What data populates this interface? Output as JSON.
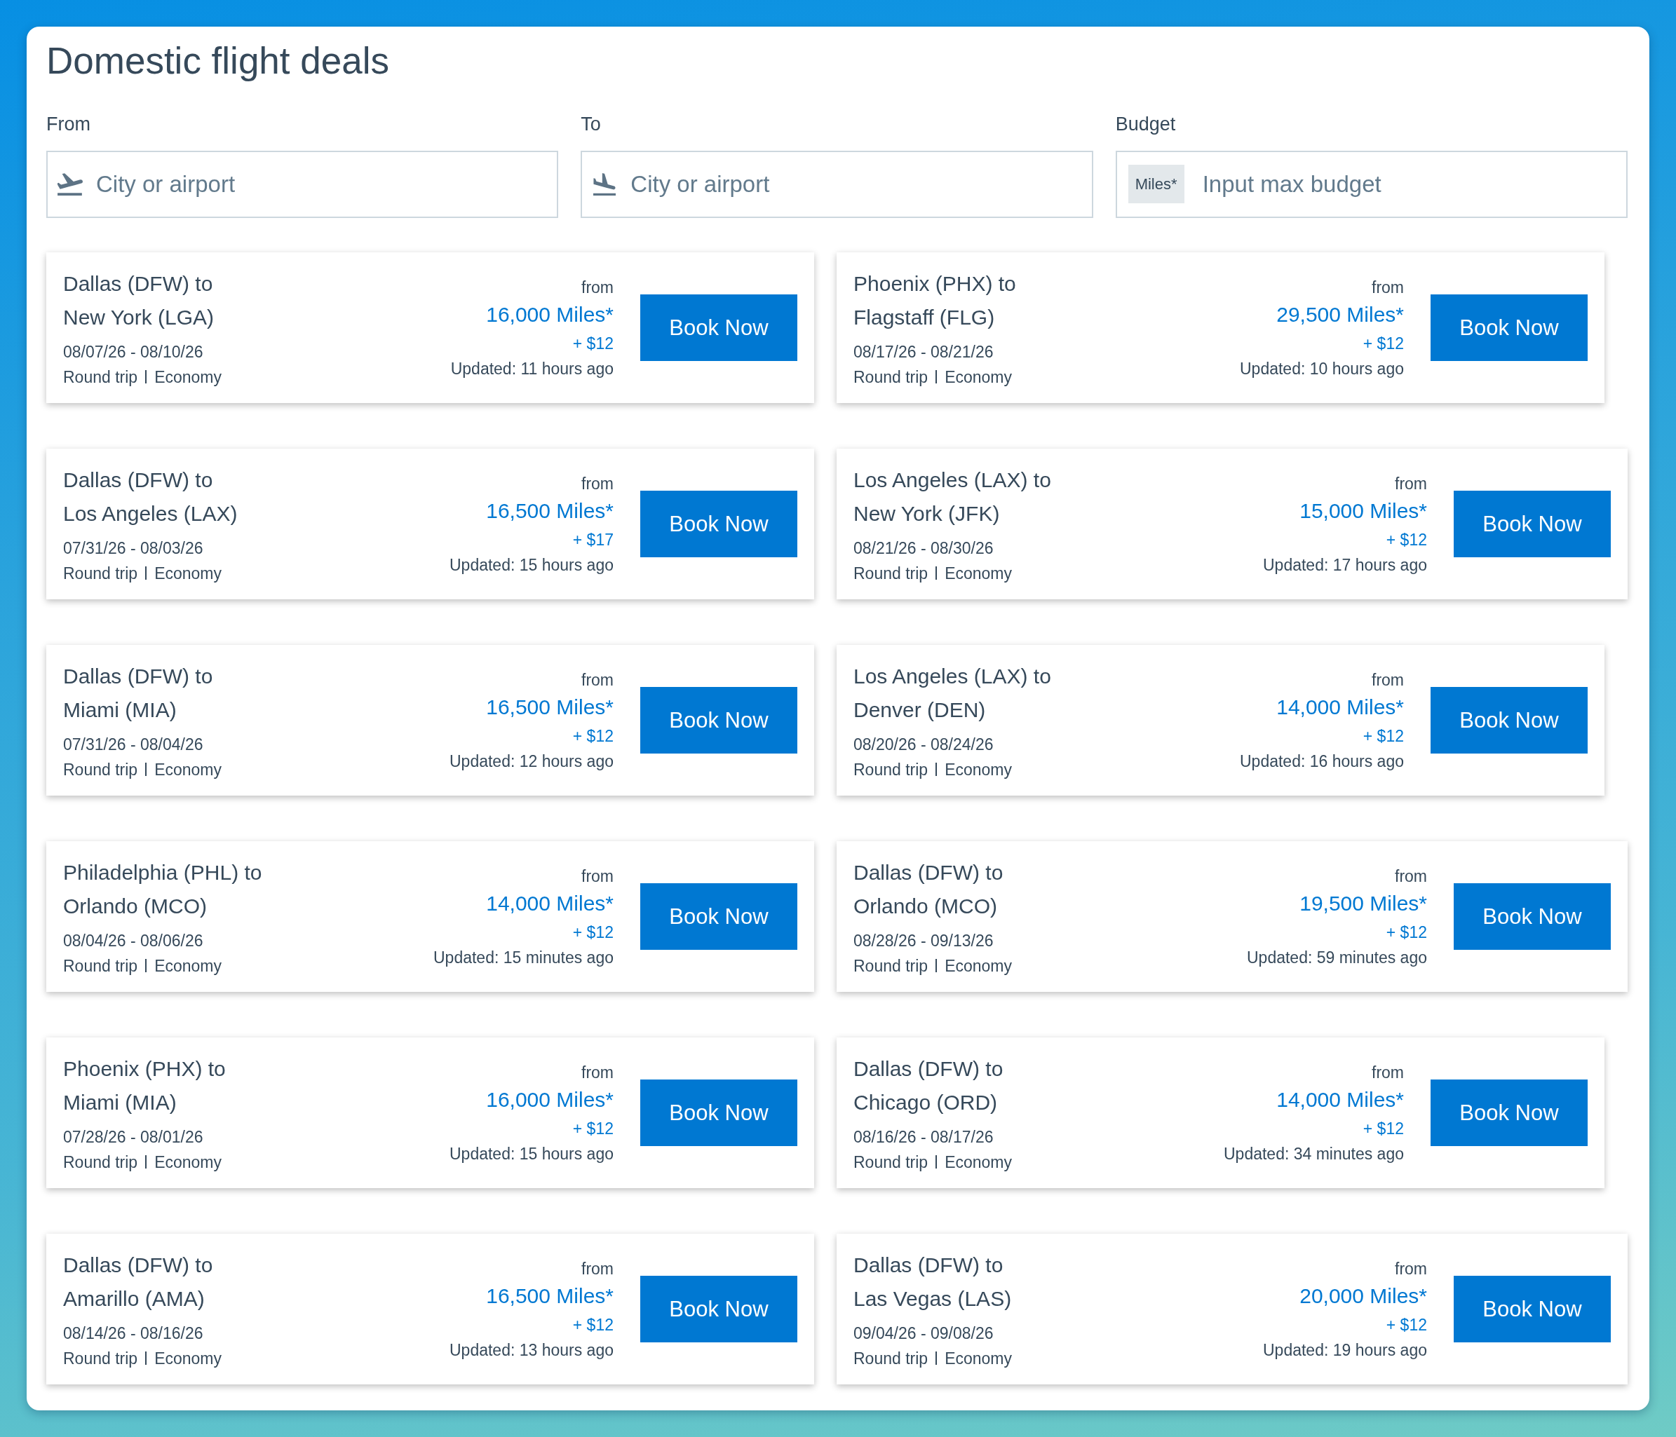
{
  "page": {
    "title": "Domestic flight deals"
  },
  "filters": [
    {
      "kind": "departure",
      "label": "From",
      "placeholder": "City or airport"
    },
    {
      "kind": "arrival",
      "label": "To",
      "placeholder": "City or airport"
    },
    {
      "kind": "budget",
      "label": "Budget",
      "unit": "Miles*",
      "placeholder": "Input max budget"
    }
  ],
  "deals": [
    {
      "route_from": "Dallas (DFW) to",
      "route_to": "New York (LGA)",
      "dates": "08/07/26 - 08/10/26",
      "trip_type": "Round trip",
      "cabin": "Economy",
      "price_prefix": "from",
      "miles": "16,000 Miles*",
      "fee": "+ $12",
      "updated": "Updated: 11 hours ago",
      "action": "Book Now"
    },
    {
      "route_from": "Phoenix (PHX) to",
      "route_to": "Flagstaff (FLG)",
      "dates": "08/17/26 - 08/21/26",
      "trip_type": "Round trip",
      "cabin": "Economy",
      "price_prefix": "from",
      "miles": "29,500 Miles*",
      "fee": "+ $12",
      "updated": "Updated: 10 hours ago",
      "action": "Book Now"
    },
    {
      "route_from": "Dallas (DFW) to",
      "route_to": "Los Angeles (LAX)",
      "dates": "07/31/26 - 08/03/26",
      "trip_type": "Round trip",
      "cabin": "Economy",
      "price_prefix": "from",
      "miles": "16,500 Miles*",
      "fee": "+ $17",
      "updated": "Updated: 15 hours ago",
      "action": "Book Now"
    },
    {
      "route_from": "Los Angeles (LAX) to",
      "route_to": "New York (JFK)",
      "dates": "08/21/26 - 08/30/26",
      "trip_type": "Round trip",
      "cabin": "Economy",
      "price_prefix": "from",
      "miles": "15,000 Miles*",
      "fee": "+ $12",
      "updated": "Updated: 17 hours ago",
      "action": "Book Now"
    },
    {
      "route_from": "Dallas (DFW) to",
      "route_to": "Miami (MIA)",
      "dates": "07/31/26 - 08/04/26",
      "trip_type": "Round trip",
      "cabin": "Economy",
      "price_prefix": "from",
      "miles": "16,500 Miles*",
      "fee": "+ $12",
      "updated": "Updated: 12 hours ago",
      "action": "Book Now"
    },
    {
      "route_from": "Los Angeles (LAX) to",
      "route_to": "Denver (DEN)",
      "dates": "08/20/26 - 08/24/26",
      "trip_type": "Round trip",
      "cabin": "Economy",
      "price_prefix": "from",
      "miles": "14,000 Miles*",
      "fee": "+ $12",
      "updated": "Updated: 16 hours ago",
      "action": "Book Now"
    },
    {
      "route_from": "Philadelphia (PHL) to",
      "route_to": "Orlando (MCO)",
      "dates": "08/04/26 - 08/06/26",
      "trip_type": "Round trip",
      "cabin": "Economy",
      "price_prefix": "from",
      "miles": "14,000 Miles*",
      "fee": "+ $12",
      "updated": "Updated: 15 minutes ago",
      "action": "Book Now"
    },
    {
      "route_from": "Dallas (DFW) to",
      "route_to": "Orlando (MCO)",
      "dates": "08/28/26 - 09/13/26",
      "trip_type": "Round trip",
      "cabin": "Economy",
      "price_prefix": "from",
      "miles": "19,500 Miles*",
      "fee": "+ $12",
      "updated": "Updated: 59 minutes ago",
      "action": "Book Now"
    },
    {
      "route_from": "Phoenix (PHX) to",
      "route_to": "Miami (MIA)",
      "dates": "07/28/26 - 08/01/26",
      "trip_type": "Round trip",
      "cabin": "Economy",
      "price_prefix": "from",
      "miles": "16,000 Miles*",
      "fee": "+ $12",
      "updated": "Updated: 15 hours ago",
      "action": "Book Now"
    },
    {
      "route_from": "Dallas (DFW) to",
      "route_to": "Chicago (ORD)",
      "dates": "08/16/26 - 08/17/26",
      "trip_type": "Round trip",
      "cabin": "Economy",
      "price_prefix": "from",
      "miles": "14,000 Miles*",
      "fee": "+ $12",
      "updated": "Updated: 34 minutes ago",
      "action": "Book Now"
    },
    {
      "route_from": "Dallas (DFW) to",
      "route_to": "Amarillo (AMA)",
      "dates": "08/14/26 - 08/16/26",
      "trip_type": "Round trip",
      "cabin": "Economy",
      "price_prefix": "from",
      "miles": "16,500 Miles*",
      "fee": "+ $12",
      "updated": "Updated: 13 hours ago",
      "action": "Book Now"
    },
    {
      "route_from": "Dallas (DFW) to",
      "route_to": "Las Vegas (LAS)",
      "dates": "09/04/26 - 09/08/26",
      "trip_type": "Round trip",
      "cabin": "Economy",
      "price_prefix": "from",
      "miles": "20,000 Miles*",
      "fee": "+ $12",
      "updated": "Updated: 19 hours ago",
      "action": "Book Now"
    }
  ]
}
